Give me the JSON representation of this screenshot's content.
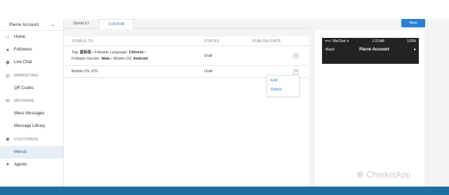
{
  "sidebar": {
    "account": "Pierre Account",
    "items": [
      {
        "label": "Home",
        "icon": "home-icon",
        "glyph": "⌂",
        "kind": "item"
      },
      {
        "label": "Followers",
        "icon": "user-icon",
        "glyph": "●",
        "kind": "item"
      },
      {
        "label": "Live Chat",
        "icon": "chat-icon",
        "glyph": "◉",
        "kind": "item"
      },
      {
        "label": "MARKETING",
        "icon": "target-icon",
        "glyph": "◎",
        "kind": "section"
      },
      {
        "label": "QR Codes",
        "kind": "sub"
      },
      {
        "label": "MESSAGE",
        "icon": "envelope-icon",
        "glyph": "✉",
        "kind": "section"
      },
      {
        "label": "Mass Messages",
        "kind": "sub"
      },
      {
        "label": "Message Library",
        "kind": "sub"
      },
      {
        "label": "CUSTOMIZE",
        "icon": "gear-icon",
        "glyph": "✱",
        "kind": "section"
      },
      {
        "label": "Menus",
        "kind": "sub",
        "active": true
      },
      {
        "label": "Agents",
        "icon": "agents-icon",
        "glyph": "●",
        "kind": "item"
      }
    ]
  },
  "tabs": [
    {
      "label": "DEFAULT",
      "active": false
    },
    {
      "label": "CUSTOM",
      "active": true
    }
  ],
  "table": {
    "headers": {
      "visible_to": "VISIBLE TO",
      "status": "STATUS",
      "publish_date": "PUBLISH DATE"
    },
    "row1": {
      "line1_prefix": "Tag: ",
      "tag": "星标组",
      "lang_label": " • Follower Language: ",
      "lang": "Chinese",
      "line1_suffix": " •",
      "gender_label": "Follower Gender: ",
      "gender": "Male",
      "os_label": " • Mobile OS: ",
      "os": "Android",
      "status": "Draft"
    },
    "row2": {
      "visible_to": "Mobile OS: iOS",
      "status": "Draft"
    }
  },
  "dropdown_glyph": "▾",
  "context_menu": {
    "edit": "Edit",
    "delete": "Delete"
  },
  "new_button": "New",
  "phone": {
    "carrier": "••••○ WeChat ✈",
    "time": "1:21AM",
    "battery": "100%",
    "back": "‹Back",
    "title": "Pierre Account"
  },
  "watermark": "CharketApp",
  "colors": {
    "accent": "#2d7fd3",
    "bottom_bar": "#1f6ea3",
    "phone_bg": "#232323"
  }
}
